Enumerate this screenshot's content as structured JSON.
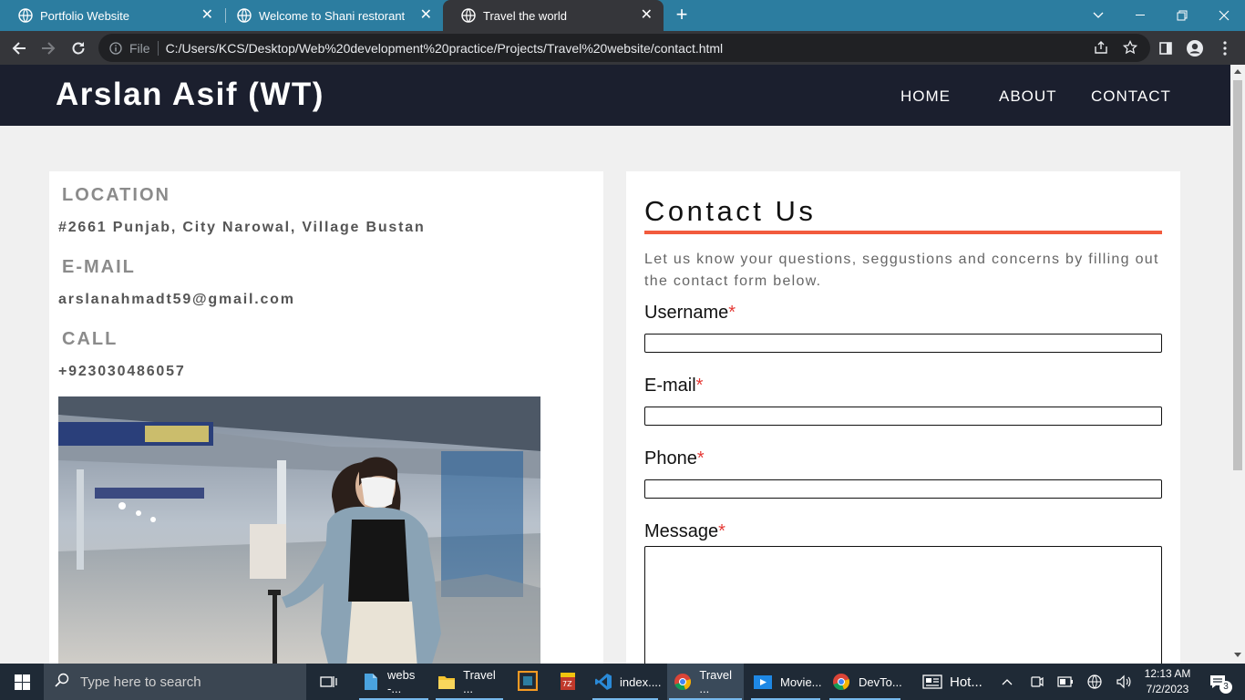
{
  "browser": {
    "tabs": [
      {
        "title": "Portfolio Website",
        "active": false
      },
      {
        "title": "Welcome to Shani restorant",
        "active": false
      },
      {
        "title": "Travel the world",
        "active": true
      }
    ],
    "url_scheme": "File",
    "url": "C:/Users/KCS/Desktop/Web%20development%20practice/Projects/Travel%20website/contact.html"
  },
  "site": {
    "brand": "Arslan Asif (WT)",
    "nav": [
      "HOME",
      "ABOUT",
      "CONTACT"
    ]
  },
  "info": {
    "location_label": "LOCATION",
    "location_value": "#2661 Punjab, City Narowal, Village Bustan",
    "email_label": "E-MAIL",
    "email_value": "arslanahmadt59@gmail.com",
    "call_label": "CALL",
    "call_value": "+923030486057"
  },
  "contact": {
    "title": "Contact Us",
    "description": "Let us know your questions, seggustions and concerns by filling out the contact form below.",
    "fields": [
      {
        "label": "Username",
        "required_mark": "*"
      },
      {
        "label": "E-mail",
        "required_mark": "*"
      },
      {
        "label": "Phone",
        "required_mark": "*"
      },
      {
        "label": "Message",
        "required_mark": "*"
      }
    ]
  },
  "colors": {
    "header_bg": "#1b1f2e",
    "accent_rule": "#f25b3d",
    "tabbar_bg": "#2c7da0",
    "required": "#e53935"
  },
  "taskbar": {
    "search_placeholder": "Type here to search",
    "items": [
      {
        "label": "webs -...",
        "icon": "file-icon"
      },
      {
        "label": "Travel ...",
        "icon": "folder-icon"
      },
      {
        "label": "index....",
        "icon": "vscode-icon"
      },
      {
        "label": "Travel ...",
        "icon": "chrome-icon"
      },
      {
        "label": "Movie...",
        "icon": "movie-icon"
      },
      {
        "label": "DevTo...",
        "icon": "chrome-icon"
      },
      {
        "label": "Hot...",
        "icon": "news-icon"
      }
    ],
    "time": "12:13 AM",
    "date": "7/2/2023",
    "notification_count": "3"
  }
}
